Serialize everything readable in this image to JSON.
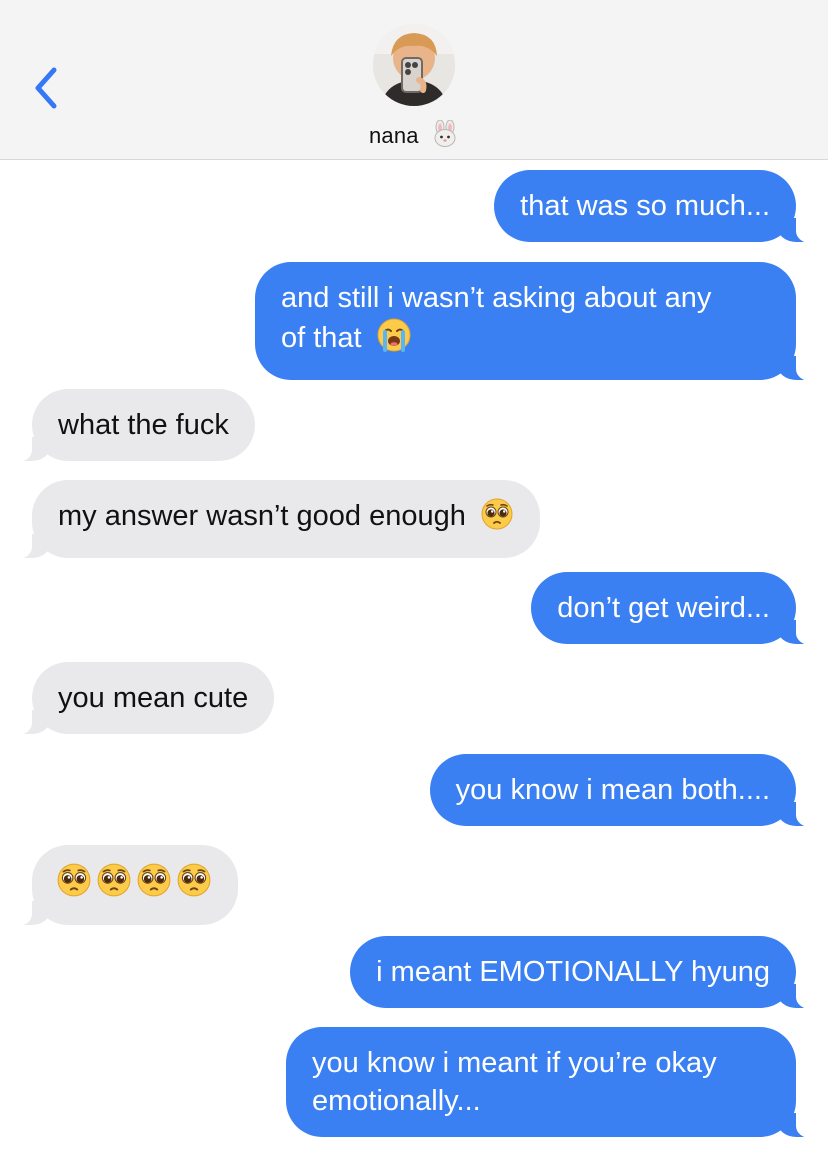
{
  "header": {
    "contact_name": "nana",
    "contact_emoji": "rabbit-face-icon",
    "back_icon": "chevron-left-icon",
    "accent": "#3478f6"
  },
  "colors": {
    "outgoing_bubble": "#3b80f2",
    "incoming_bubble": "#e9e9eb"
  },
  "messages": [
    {
      "direction": "out",
      "text": "that was so much..."
    },
    {
      "direction": "out",
      "text_line1": "and still i wasn’t asking about any",
      "text_line2": "of that",
      "emoji": "loudly-crying-face-icon"
    },
    {
      "direction": "in",
      "text": "what the fuck"
    },
    {
      "direction": "in",
      "text": "my answer wasn’t good enough",
      "emoji": "pleading-face-icon"
    },
    {
      "direction": "out",
      "text": "don’t get weird..."
    },
    {
      "direction": "in",
      "text": "you mean cute"
    },
    {
      "direction": "out",
      "text": "you know i mean both...."
    },
    {
      "direction": "in",
      "emojis": [
        "pleading-face-icon",
        "pleading-face-icon",
        "pleading-face-icon",
        "pleading-face-icon"
      ]
    },
    {
      "direction": "out",
      "text": "i meant EMOTIONALLY hyung"
    },
    {
      "direction": "out",
      "text_line1": "you know i meant if you’re okay",
      "text_line2": "emotionally..."
    }
  ]
}
